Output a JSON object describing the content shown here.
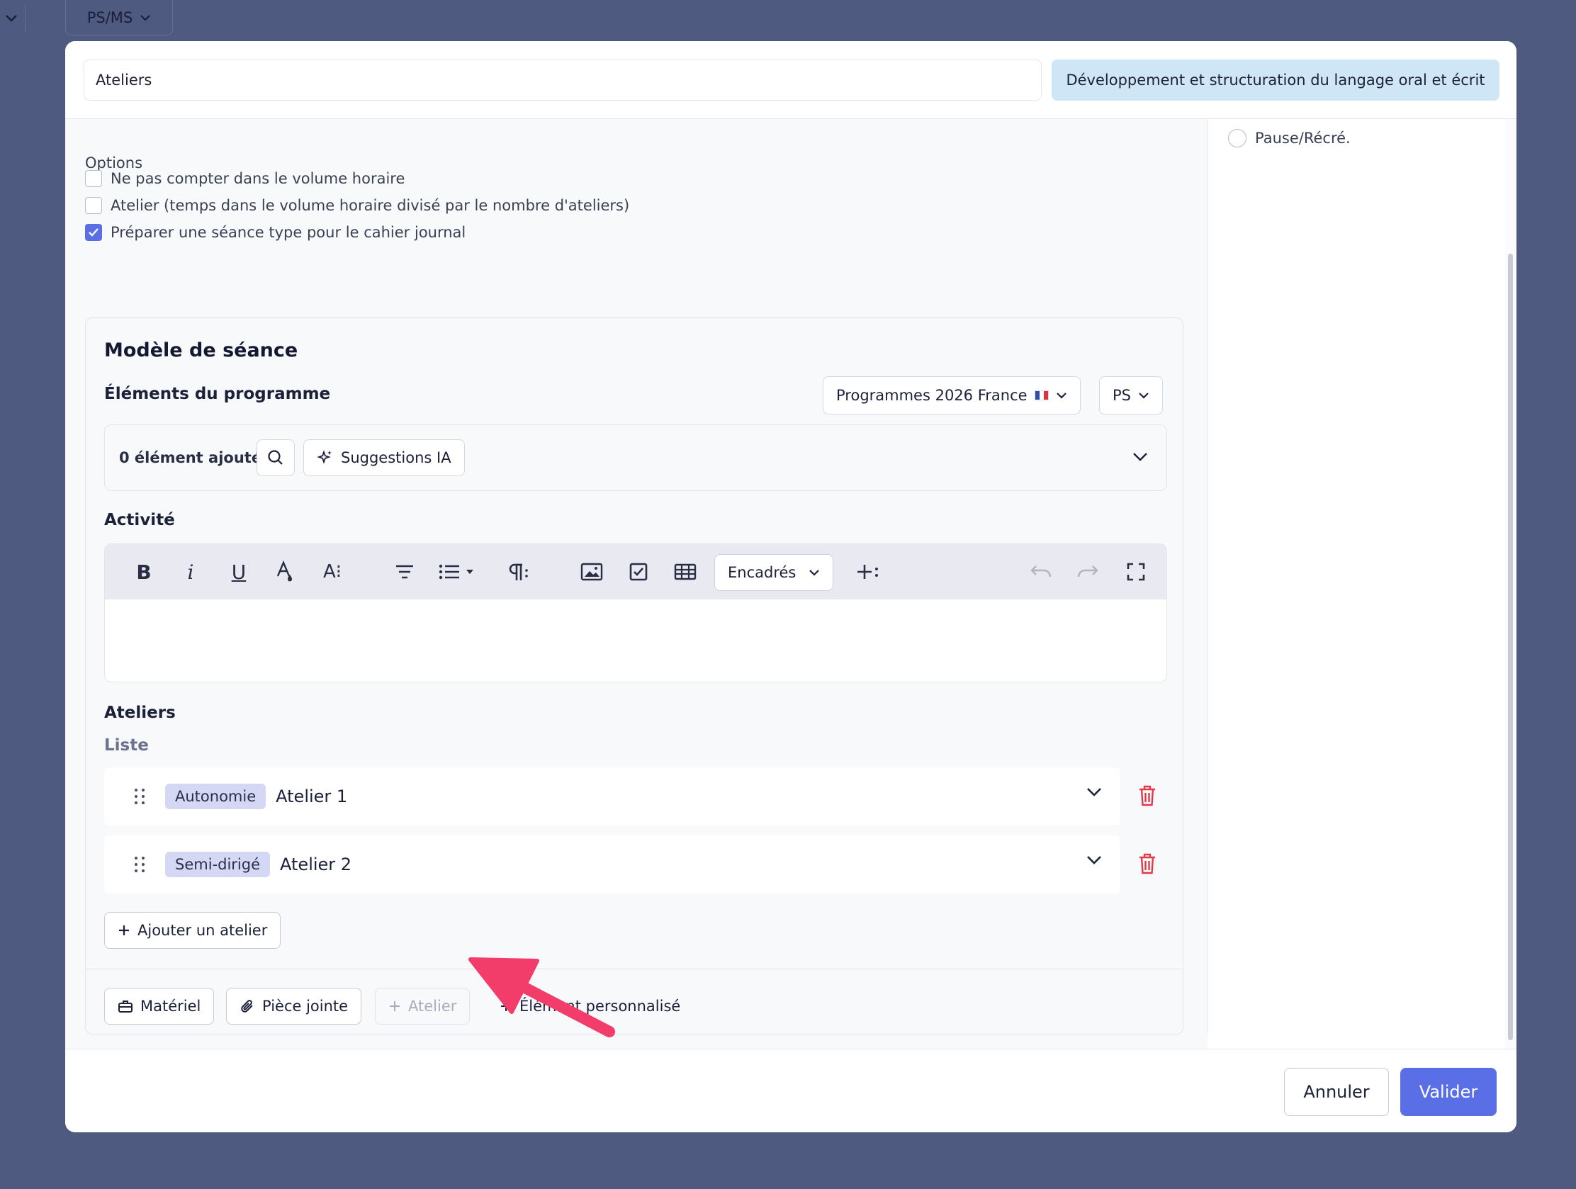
{
  "background": {
    "level_selector": "PS/MS"
  },
  "modal": {
    "title_value": "Ateliers",
    "title_placeholder": "",
    "domain_badge": "Développement et structuration du langage oral et écrit",
    "side": {
      "radio_label": "Pause/Récré."
    },
    "options": {
      "label": "Options",
      "items": [
        {
          "label": "Ne pas compter dans le volume horaire",
          "checked": false
        },
        {
          "label": "Atelier (temps dans le volume horaire divisé par le nombre d'ateliers)",
          "checked": false
        },
        {
          "label": "Préparer une séance type pour le cahier journal",
          "checked": true
        }
      ]
    },
    "template": {
      "title": "Modèle de séance",
      "program_heading": "Éléments du programme",
      "program_select": "Programmes 2026 France",
      "level_select": "PS",
      "added_count": "0 élément ajouté",
      "ai_button": "Suggestions IA",
      "activity_heading": "Activité",
      "toolbar": {
        "bold": "B",
        "italic": "i",
        "underline": "U",
        "font_size": "A⁝",
        "callouts": "Encadrés"
      },
      "ateliers_heading": "Ateliers",
      "list_heading": "Liste",
      "ateliers": [
        {
          "tag": "Autonomie",
          "name": "Atelier 1"
        },
        {
          "tag": "Semi-dirigé",
          "name": "Atelier 2"
        }
      ],
      "add_atelier": "Ajouter un atelier",
      "footer": {
        "materiel": "Matériel",
        "attachment": "Pièce jointe",
        "atelier": "Atelier",
        "custom": "Élément personnalisé"
      }
    },
    "actions": {
      "cancel": "Annuler",
      "submit": "Valider"
    }
  },
  "colors": {
    "accent": "#5a6ee6",
    "badge": "#cfe6f6",
    "tag": "#d4d8f5",
    "danger": "#e03a4a",
    "annotation": "#f23d6b"
  }
}
